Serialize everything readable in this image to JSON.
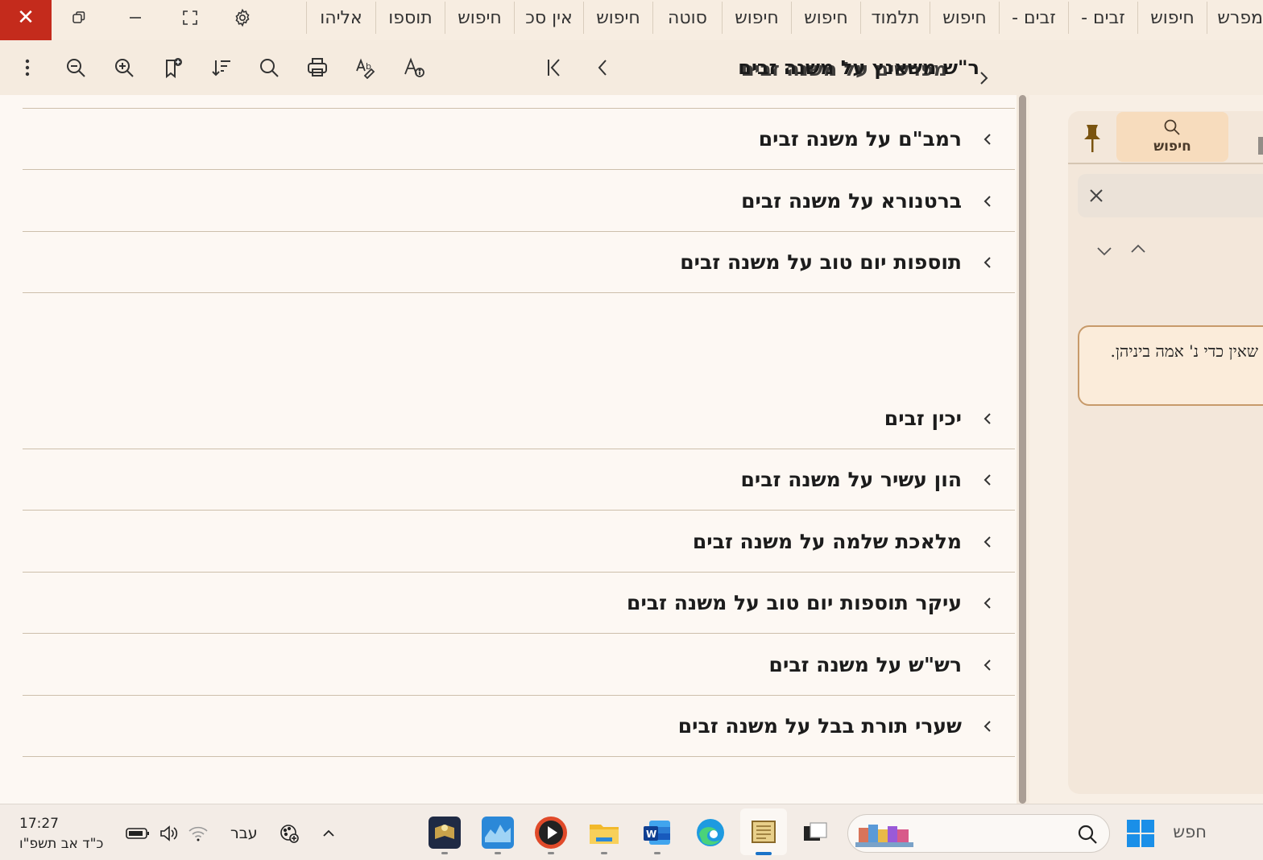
{
  "window": {
    "close_glyph": "✕",
    "tabs": [
      "מפרש",
      "חיפוש",
      "זבים -",
      "זבים -",
      "חיפוש",
      "תלמוד",
      "חיפוש",
      "חיפוש",
      "סוטה",
      "חיפוש",
      "אין סכ",
      "חיפוש",
      "תוספו",
      "אליהו"
    ]
  },
  "toolbar": {
    "doc_title": "ר\"ש משאנץ על משנה זבים",
    "overlay_title": "מפרשים על משנה זבים",
    "icons": [
      "more-icon",
      "zoom-out-icon",
      "zoom-in-icon",
      "add-bookmark-icon",
      "sort-icon",
      "search-icon",
      "print-icon",
      "spellcheck-icon",
      "font-info-icon"
    ]
  },
  "commentaries": [
    {
      "label": "רמב\"ם על משנה זבים"
    },
    {
      "label": "ברטנורא על משנה זבים"
    },
    {
      "label": "תוספות יום טוב על משנה זבים"
    },
    {
      "label": "יכין זבים"
    },
    {
      "label": "הון עשיר על משנה זבים"
    },
    {
      "label": "מלאכת שלמה על משנה זבים"
    },
    {
      "label": "עיקר תוספות יום טוב על משנה זבים"
    },
    {
      "label": "רש\"ש על משנה זבים"
    },
    {
      "label": "שערי תורת בבל על משנה זבים"
    }
  ],
  "panel": {
    "search_tab_label": "חיפוש",
    "result_text": "שאין כדי נ' אמה ביניהן."
  },
  "taskbar": {
    "time": "17:27",
    "date": "כ\"ד אב תשפ\"ו",
    "language": "עבר",
    "search_placeholder": "חפש"
  },
  "colors": {
    "accent": "#c42b1c",
    "background": "#fdf8f3",
    "tab_active": "#f7dcbd",
    "card_border": "#c79a6a"
  }
}
